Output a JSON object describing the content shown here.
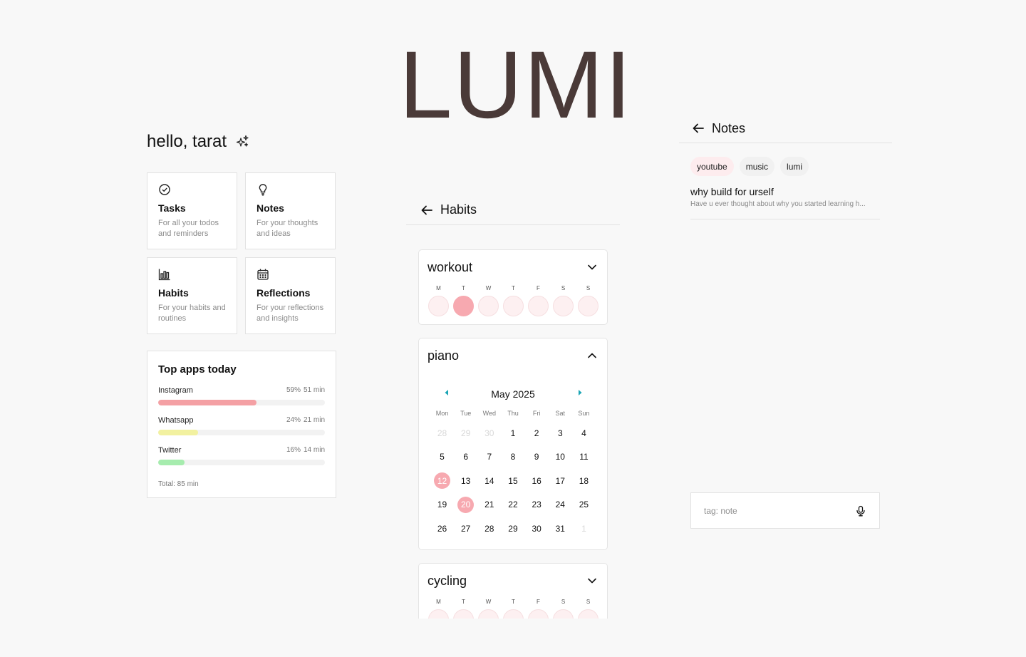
{
  "app": {
    "logo": "LUMI"
  },
  "home": {
    "greeting": "hello, tarat",
    "cards": [
      {
        "title": "Tasks",
        "desc": "For all your todos and reminders",
        "icon": "check-circle-icon"
      },
      {
        "title": "Notes",
        "desc": "For your thoughts and ideas",
        "icon": "lightbulb-icon"
      },
      {
        "title": "Habits",
        "desc": "For your habits and routines",
        "icon": "bar-chart-icon"
      },
      {
        "title": "Reflections",
        "desc": "For your reflections and insights",
        "icon": "calendar-icon"
      }
    ],
    "top_apps": {
      "title": "Top apps today",
      "apps": [
        {
          "name": "Instagram",
          "percent": "59%",
          "time": "51 min",
          "fill": 0.59,
          "color": "#f4a0a4"
        },
        {
          "name": "Whatsapp",
          "percent": "24%",
          "time": "21 min",
          "fill": 0.24,
          "color": "#f2f1a0"
        },
        {
          "name": "Twitter",
          "percent": "16%",
          "time": "14 min",
          "fill": 0.16,
          "color": "#a6ecae"
        }
      ],
      "total": "Total: 85 min"
    }
  },
  "habits": {
    "title": "Habits",
    "weekday_letters": [
      "M",
      "T",
      "W",
      "T",
      "F",
      "S",
      "S"
    ],
    "workout": {
      "name": "workout",
      "done": [
        false,
        true,
        false,
        false,
        false,
        false,
        false
      ]
    },
    "piano": {
      "name": "piano",
      "month": "May 2025",
      "weekday_names": [
        "Mon",
        "Tue",
        "Wed",
        "Thu",
        "Fri",
        "Sat",
        "Sun"
      ],
      "weeks": [
        [
          "28",
          "29",
          "30",
          "1",
          "2",
          "3",
          "4"
        ],
        [
          "5",
          "6",
          "7",
          "8",
          "9",
          "10",
          "11"
        ],
        [
          "12",
          "13",
          "14",
          "15",
          "16",
          "17",
          "18"
        ],
        [
          "19",
          "20",
          "21",
          "22",
          "23",
          "24",
          "25"
        ],
        [
          "26",
          "27",
          "28",
          "29",
          "30",
          "31",
          "1"
        ]
      ],
      "muted_cells": [
        "0-0",
        "0-1",
        "0-2",
        "4-6"
      ],
      "selected_cells": [
        "2-0",
        "3-1"
      ]
    },
    "cycling": {
      "name": "cycling"
    }
  },
  "notes": {
    "title": "Notes",
    "tags": [
      "youtube",
      "music",
      "lumi"
    ],
    "active_tag": "youtube",
    "items": [
      {
        "title": "why build for urself",
        "preview": "Have u ever thought about why you started learning h..."
      }
    ],
    "input_placeholder": "tag: note"
  },
  "colors": {
    "accent_pink": "#f7a9b0",
    "logo": "#4a3a38",
    "arrow_teal": "#1aa5b5"
  }
}
